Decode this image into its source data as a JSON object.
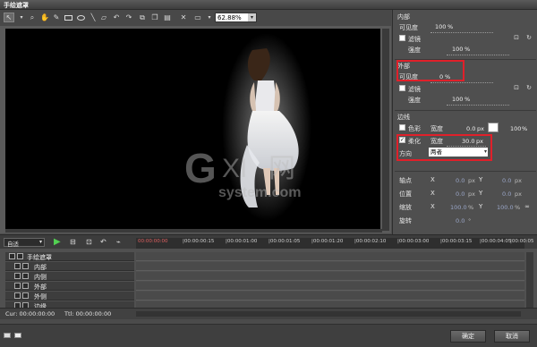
{
  "window": {
    "title": "手绘遮罩"
  },
  "toolbar": {
    "zoom": "62.88%",
    "zoom_dropdown_icon": "chevron-down-icon"
  },
  "inner": {
    "heading": "内部",
    "visibility_label": "可见度",
    "visibility_value": "100",
    "visibility_unit": "%",
    "filter_label": "滤镜",
    "strength_label": "强度",
    "strength_value": "100",
    "strength_unit": "%"
  },
  "outer": {
    "heading": "外部",
    "visibility_label": "可见度",
    "visibility_value": "0",
    "visibility_unit": "%",
    "filter_label": "滤镜",
    "strength_label": "强度",
    "strength_value": "100",
    "strength_unit": "%"
  },
  "edge": {
    "heading": "边线",
    "color_label": "色彩",
    "width_label": "宽度",
    "color_width_value": "0.0",
    "color_width_unit": "px",
    "color_opacity": "100",
    "color_opacity_unit": "%",
    "soften_label": "柔化",
    "soften_width_label": "宽度",
    "soften_width_value": "30.0",
    "soften_width_unit": "px",
    "direction_label": "方向",
    "direction_value": "两者"
  },
  "transform": {
    "anchor_label": "轴点",
    "position_label": "位置",
    "scale_label": "缩放",
    "rotate_label": "旋转",
    "x_label": "X",
    "y_label": "Y",
    "anchor_x": "0.0",
    "anchor_y": "0.0",
    "pos_x": "0.0",
    "pos_y": "0.0",
    "scale_x": "100.0",
    "scale_y": "100.0",
    "rotate_value": "0.0",
    "px_unit": "px",
    "pct_unit": "%",
    "deg_unit": "°"
  },
  "timeline": {
    "mode": "自适",
    "ruler_ticks": [
      "00:00:00:00",
      "|00:00:00:15",
      "|00:00:01:00",
      "|00:00:01:05",
      "|00:00:01:20",
      "|00:00:02:10",
      "|00:00:03:00",
      "|00:00:03:15",
      "|00:00:04:05",
      "|00:00:05"
    ],
    "tracks": [
      "手绘遮罩",
      "内部",
      "内侧",
      "外部",
      "外侧",
      "边缘"
    ]
  },
  "status": {
    "cur": "Cur: 00:00:00:00",
    "ttl": "Ttl: 00:00:00:00"
  },
  "footer": {
    "ok": "确定",
    "cancel": "取消"
  },
  "watermark": "G XI 网 system.com"
}
